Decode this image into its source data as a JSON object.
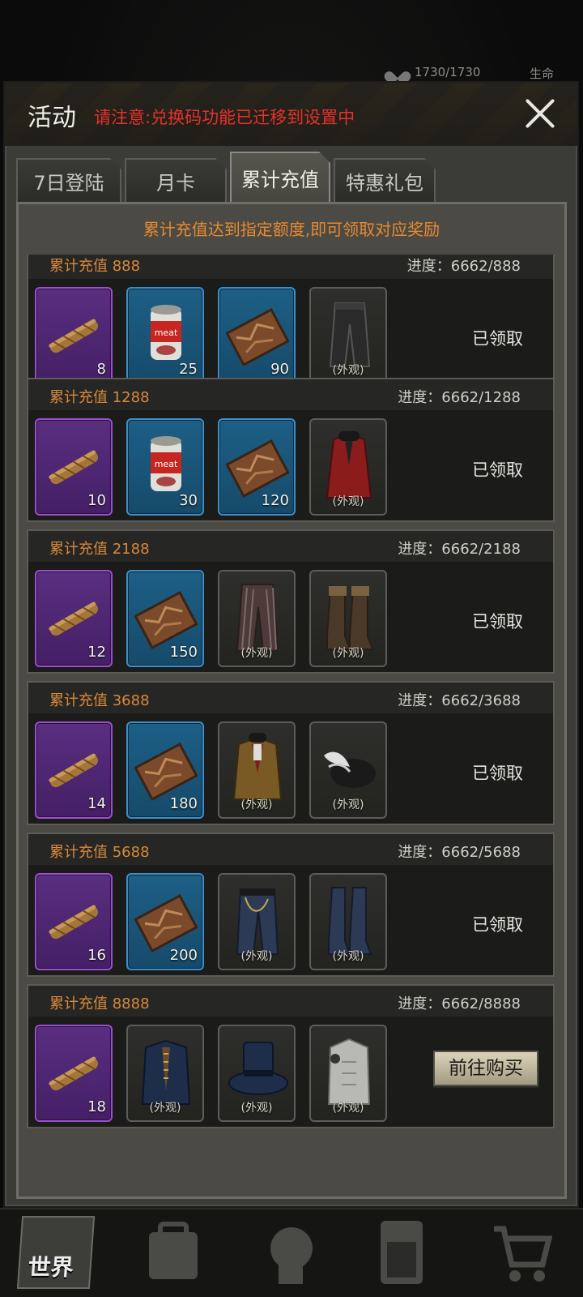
{
  "status_bar": {
    "hp_value": "1730/1730",
    "life_label": "生命"
  },
  "dialog": {
    "title": "活动",
    "notice": "请注意:兑换码功能已迁移到设置中",
    "tabs": [
      {
        "label": "7日登陆",
        "active": false
      },
      {
        "label": "月卡",
        "active": false
      },
      {
        "label": "累计充值",
        "active": true
      },
      {
        "label": "特惠礼包",
        "active": false
      }
    ],
    "banner": "累计充值达到指定额度,即可领取对应奖励",
    "skin_tag": "(外观)",
    "tiers": [
      {
        "label": "累计充值 888",
        "progress": "进度：6662/888",
        "status": "已领取",
        "items": [
          {
            "kind": "cigar",
            "rarity": "purple",
            "qty": "8"
          },
          {
            "kind": "meat-can",
            "rarity": "blue",
            "qty": "25"
          },
          {
            "kind": "map-box",
            "rarity": "blue",
            "qty": "90"
          },
          {
            "kind": "pants-black",
            "rarity": "gray",
            "skin": true
          }
        ]
      },
      {
        "label": "累计充值",
        "amount": "1288",
        "progress": "进度：6662/1288",
        "status": "已领取",
        "items": [
          {
            "kind": "cigar",
            "rarity": "purple",
            "qty": "10"
          },
          {
            "kind": "meat-can",
            "rarity": "blue",
            "qty": "30"
          },
          {
            "kind": "map-box",
            "rarity": "blue",
            "qty": "120"
          },
          {
            "kind": "red-coat",
            "rarity": "gray",
            "skin": true
          }
        ]
      },
      {
        "label": "累计充值",
        "amount": "2188",
        "progress": "进度：6662/2188",
        "status": "已领取",
        "items": [
          {
            "kind": "cigar",
            "rarity": "purple",
            "qty": "12"
          },
          {
            "kind": "map-box",
            "rarity": "blue",
            "qty": "150"
          },
          {
            "kind": "striped-pants",
            "rarity": "gray",
            "skin": true
          },
          {
            "kind": "boots-brown",
            "rarity": "gray",
            "skin": true
          }
        ]
      },
      {
        "label": "累计充值",
        "amount": "3688",
        "progress": "进度：6662/3688",
        "status": "已领取",
        "items": [
          {
            "kind": "cigar",
            "rarity": "purple",
            "qty": "14"
          },
          {
            "kind": "map-box",
            "rarity": "blue",
            "qty": "180"
          },
          {
            "kind": "brown-jacket",
            "rarity": "gray",
            "skin": true
          },
          {
            "kind": "feather-hat",
            "rarity": "gray",
            "skin": true
          }
        ]
      },
      {
        "label": "累计充值",
        "amount": "5688",
        "progress": "进度：6662/5688",
        "status": "已领取",
        "items": [
          {
            "kind": "cigar",
            "rarity": "purple",
            "qty": "16"
          },
          {
            "kind": "map-box",
            "rarity": "blue",
            "qty": "200"
          },
          {
            "kind": "jeans-chain",
            "rarity": "gray",
            "skin": true
          },
          {
            "kind": "boots-blue",
            "rarity": "gray",
            "skin": true
          }
        ]
      },
      {
        "label": "累计充值",
        "amount": "8888",
        "progress": "进度：6662/8888",
        "status": "前往购买",
        "items": [
          {
            "kind": "cigar",
            "rarity": "purple",
            "qty": "18"
          },
          {
            "kind": "blue-coat",
            "rarity": "gray",
            "skin": true
          },
          {
            "kind": "top-hat",
            "rarity": "gray",
            "skin": true
          },
          {
            "kind": "tattoo-body",
            "rarity": "gray",
            "skin": true
          }
        ]
      }
    ]
  },
  "bottom_nav": {
    "world_label": "世界"
  },
  "colors": {
    "accent_orange": "#e8892f",
    "notice_red": "#e8302a",
    "purple_rarity": "#9a4fd1",
    "blue_rarity": "#3b8ecc"
  }
}
